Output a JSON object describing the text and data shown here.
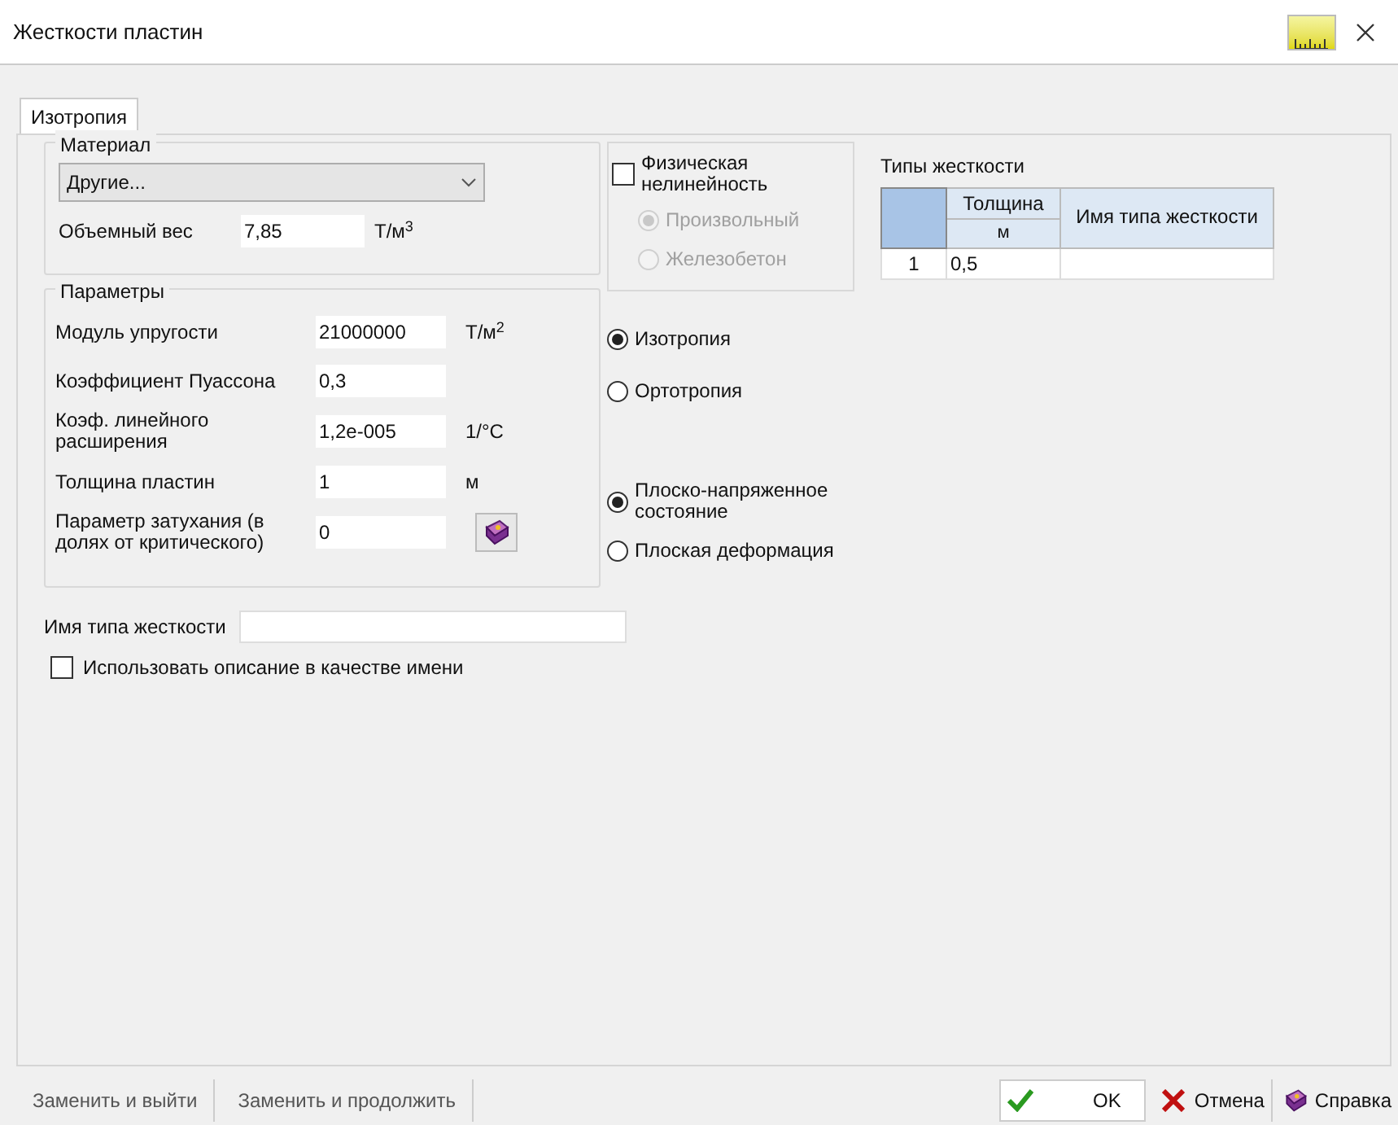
{
  "window": {
    "title": "Жесткости пластин"
  },
  "tabs": [
    {
      "label": "Изотропия",
      "selected": true
    }
  ],
  "material": {
    "legend": "Материал",
    "dropdown": "Другие...",
    "weight_label": "Объемный вес",
    "weight_value": "7,85",
    "weight_unit": "Т/м$^{3}$"
  },
  "parameters": {
    "legend": "Параметры",
    "rows": [
      {
        "label": "Модуль упругости",
        "value": "21000000",
        "unit": "Т/м$^{2}$",
        "kind": "unit"
      },
      {
        "label": "Коэффициент Пуассона",
        "value": "0,3",
        "kind": "plain"
      },
      {
        "label": "Коэф. линейного расширения",
        "value": "1,2e-005",
        "unit": "1/°С",
        "kind": "unit"
      },
      {
        "label": "Толщина пластин",
        "value": "1",
        "unit": "м",
        "kind": "unit"
      },
      {
        "label": "Параметр затухания (в долях от критического)",
        "value": "0",
        "kind": "book"
      }
    ]
  },
  "nonlinearity": {
    "label": "Физическая нелинейность",
    "checked": false,
    "options": [
      {
        "label": "Произвольный",
        "selected": true,
        "disabled": true
      },
      {
        "label": "Железобетон",
        "selected": false,
        "disabled": true
      }
    ]
  },
  "anisotropy": [
    {
      "label": "Изотропия",
      "selected": true
    },
    {
      "label": "Ортотропия",
      "selected": false
    }
  ],
  "stress_state": [
    {
      "label": "Плоско-напряженное состояние",
      "selected": true
    },
    {
      "label": "Плоская деформация",
      "selected": false
    }
  ],
  "stiffness_table": {
    "title": "Типы жесткости",
    "columns": [
      {
        "label": "Толщина",
        "unit": "м"
      },
      {
        "label": "Имя типа жесткости"
      }
    ],
    "rows": [
      {
        "index": "1",
        "cells": [
          "0,5",
          ""
        ]
      }
    ]
  },
  "name_field": {
    "label": "Имя типа жесткости"
  },
  "use_description": {
    "label": "Использовать описание в качестве имени",
    "checked": false
  },
  "footer": {
    "left_buttons": [
      "Заменить и выйти",
      "Заменить и продолжить"
    ],
    "ok": "OK",
    "cancel": "Отмена",
    "help": "Справка"
  }
}
